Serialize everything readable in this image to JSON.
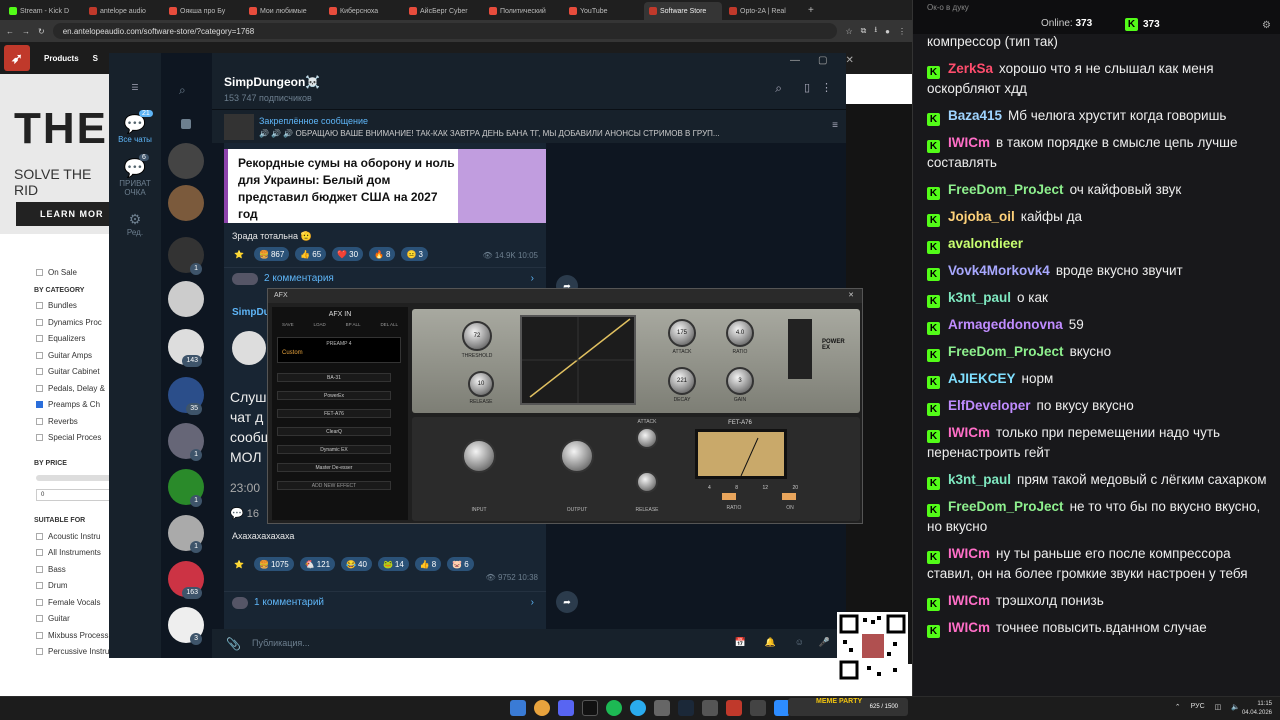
{
  "browser": {
    "tabs": [
      "Stream - Kick D",
      "antelope audio",
      "Оякша про Бу",
      "Мои любимые",
      "Киберсноха",
      "АйсБерг Cyber",
      "Политический",
      "YouTube",
      "Software Store",
      "Opto-2A | Real"
    ],
    "active_tab": 8,
    "url": "en.antelopeaudio.com/software-store/?category=1768"
  },
  "site": {
    "nav": [
      "Products",
      "S"
    ],
    "hero_title": "THE",
    "hero_sub": "SOLVE THE RID",
    "hero_button": "LEARN MOR",
    "on_sale": "On Sale",
    "by_category": "BY CATEGORY",
    "categories": [
      "Bundles",
      "Dynamics Proc",
      "Equalizers",
      "Guitar Amps",
      "Guitar Cabinet",
      "Pedals, Delay &",
      "Preamps & Ch",
      "Reverbs",
      "Special Proces"
    ],
    "by_price": "BY PRICE",
    "price_value": "0",
    "suitable_for": "SUITABLE FOR",
    "instruments": [
      "Acoustic Instru",
      "All Instruments",
      "Bass",
      "Drum",
      "Female Vocals",
      "Guitar",
      "Mixbuss Processing",
      "Percussive Instruments"
    ]
  },
  "telegram": {
    "sidebar": {
      "all_chats": "Все чаты",
      "all_badge": "21",
      "private": "ПРИВАТ ОЧКА",
      "private_badge": "6",
      "edit": "Ред."
    },
    "channel_name": "SimpDungeon☠️",
    "subscribers": "153 747 подписчиков",
    "pinned_title": "Закреплённое сообщение",
    "pinned_text": "🔊 🔊 🔊 ОБРАЩАЮ ВАШЕ ВНИМАНИЕ! ТАК-КАК ЗАВТРА ДЕНЬ БАНА ТГ, МЫ ДОБАВИЛИ АНОНСЫ СТРИМОВ В ГРУП...",
    "chat_badges": [
      "",
      "",
      "1",
      "",
      "143",
      "35",
      "1",
      "1",
      "1",
      "163",
      "3"
    ],
    "post1": {
      "headline": "Рекордные сумы на оборону и ноль для Украины: Белый дом представил бюджет США на 2027 год",
      "text": "Зрада тотальна 🫡",
      "reactions": [
        {
          "e": "⭐",
          "n": ""
        },
        {
          "e": "🍔",
          "n": "867"
        },
        {
          "e": "👍",
          "n": "65"
        },
        {
          "e": "❤️",
          "n": "30"
        },
        {
          "e": "🔥",
          "n": "8"
        },
        {
          "e": "😐",
          "n": "3"
        }
      ],
      "views": "14.9K",
      "time": "10:05",
      "comments": "2 комментария"
    },
    "post2": {
      "author": "SimpDu",
      "text_lines": [
        "Слуш",
        "чат д",
        "сообщ",
        "МОЛ"
      ],
      "time": "23:00",
      "small": "16",
      "footer_text": "Ахахахахахаха",
      "reactions": [
        {
          "e": "⭐",
          "n": ""
        },
        {
          "e": "🍔",
          "n": "1075"
        },
        {
          "e": "🐔",
          "n": "121"
        },
        {
          "e": "😂",
          "n": "40"
        },
        {
          "e": "🐸",
          "n": "14"
        },
        {
          "e": "👍",
          "n": "8"
        },
        {
          "e": "🐷",
          "n": "6"
        }
      ],
      "views": "9752",
      "time2": "10:38",
      "comments": "1 комментарий"
    },
    "input_placeholder": "Публикация..."
  },
  "afx": {
    "title": "AFX",
    "panel_title": "AFX IN",
    "panel_buttons": [
      "SAVE",
      "LOAD",
      "BP ALL",
      "DEL ALL"
    ],
    "preset_title": "PREAMP 4",
    "preset": "Custom",
    "slots": [
      "BA-31",
      "PowerEx",
      "FET-A76",
      "ClearQ",
      "Dynamic EX",
      "Master De-esser"
    ],
    "add_effect": "ADD NEW EFFECT",
    "comp1": {
      "threshold": "72",
      "attack": "175",
      "ratio": "4.0",
      "release": "10",
      "decay": "221",
      "gain": "3",
      "labels": [
        "THRESHOLD",
        "ATTACK",
        "RATIO",
        "RELEASE",
        "DECAY",
        "GAIN"
      ],
      "brand": "POWER EX"
    },
    "comp2": {
      "name": "FET-A76",
      "labels": [
        "INPUT",
        "OUTPUT",
        "ATTACK",
        "RELEASE",
        "RATIO",
        "ON"
      ],
      "ratio_steps": [
        "4",
        "8",
        "12",
        "20"
      ]
    }
  },
  "chat": {
    "top_label": "Ок-о в дуку",
    "online_label": "Online:",
    "online": "373",
    "viewers": "373",
    "messages": [
      {
        "user": "",
        "color": "#ffffff",
        "text": "компрессор (тип так)"
      },
      {
        "user": "ZerkSa",
        "color": "#ff4d6d",
        "text": "хорошо что я не слышал как меня оскорбляют хдд"
      },
      {
        "user": "Baza415",
        "color": "#9fd4ff",
        "text": "Мб челюга хрустит когда говоришь"
      },
      {
        "user": "IWICm",
        "color": "#ff6ec7",
        "text": "в таком порядке в смысле цепь лучше составлять"
      },
      {
        "user": "FreeDom_ProJect",
        "color": "#8ef08e",
        "text": "оч кайфовый звук"
      },
      {
        "user": "Jojoba_oil",
        "color": "#ffd27a",
        "text": "кайфы да"
      },
      {
        "user": "avalondieer",
        "color": "#c8ff70",
        "text": ""
      },
      {
        "user": "Vovk4Morkovk4",
        "color": "#a8a8ff",
        "text": "вроде вкусно звучит"
      },
      {
        "user": "k3nt_paul",
        "color": "#7fe8c0",
        "text": "о как"
      },
      {
        "user": "Armageddonovna",
        "color": "#c08cff",
        "text": "59"
      },
      {
        "user": "FreeDom_ProJect",
        "color": "#8ef08e",
        "text": "вкусно"
      },
      {
        "user": "AJIEKCEY",
        "color": "#7fdfff",
        "text": "норм"
      },
      {
        "user": "ElfDeveloper",
        "color": "#c08cff",
        "text": "по вкусу вкусно"
      },
      {
        "user": "IWICm",
        "color": "#ff6ec7",
        "text": "только при перемещении надо чуть перенастроить гейт"
      },
      {
        "user": "k3nt_paul",
        "color": "#7fe8c0",
        "text": "прям такой медовый с лёгким сахарком"
      },
      {
        "user": "FreeDom_ProJect",
        "color": "#8ef08e",
        "text": "не то что бы по вкусно вкусно, но вкусно"
      },
      {
        "user": "IWICm",
        "color": "#ff6ec7",
        "text": "ну ты раньше его после компрессора ставил, он на более громкие звуки настроен у тебя"
      },
      {
        "user": "IWICm",
        "color": "#ff6ec7",
        "text": "трэшхолд понизь"
      },
      {
        "user": "IWICm",
        "color": "#ff6ec7",
        "text": "точнее повысить.вданном случае"
      }
    ]
  },
  "taskbar": {
    "meme": "MEME PARTY",
    "meme_progress": "625 / 1500",
    "lang": "РУС",
    "time": "11:15",
    "date": "04.04.2026"
  }
}
